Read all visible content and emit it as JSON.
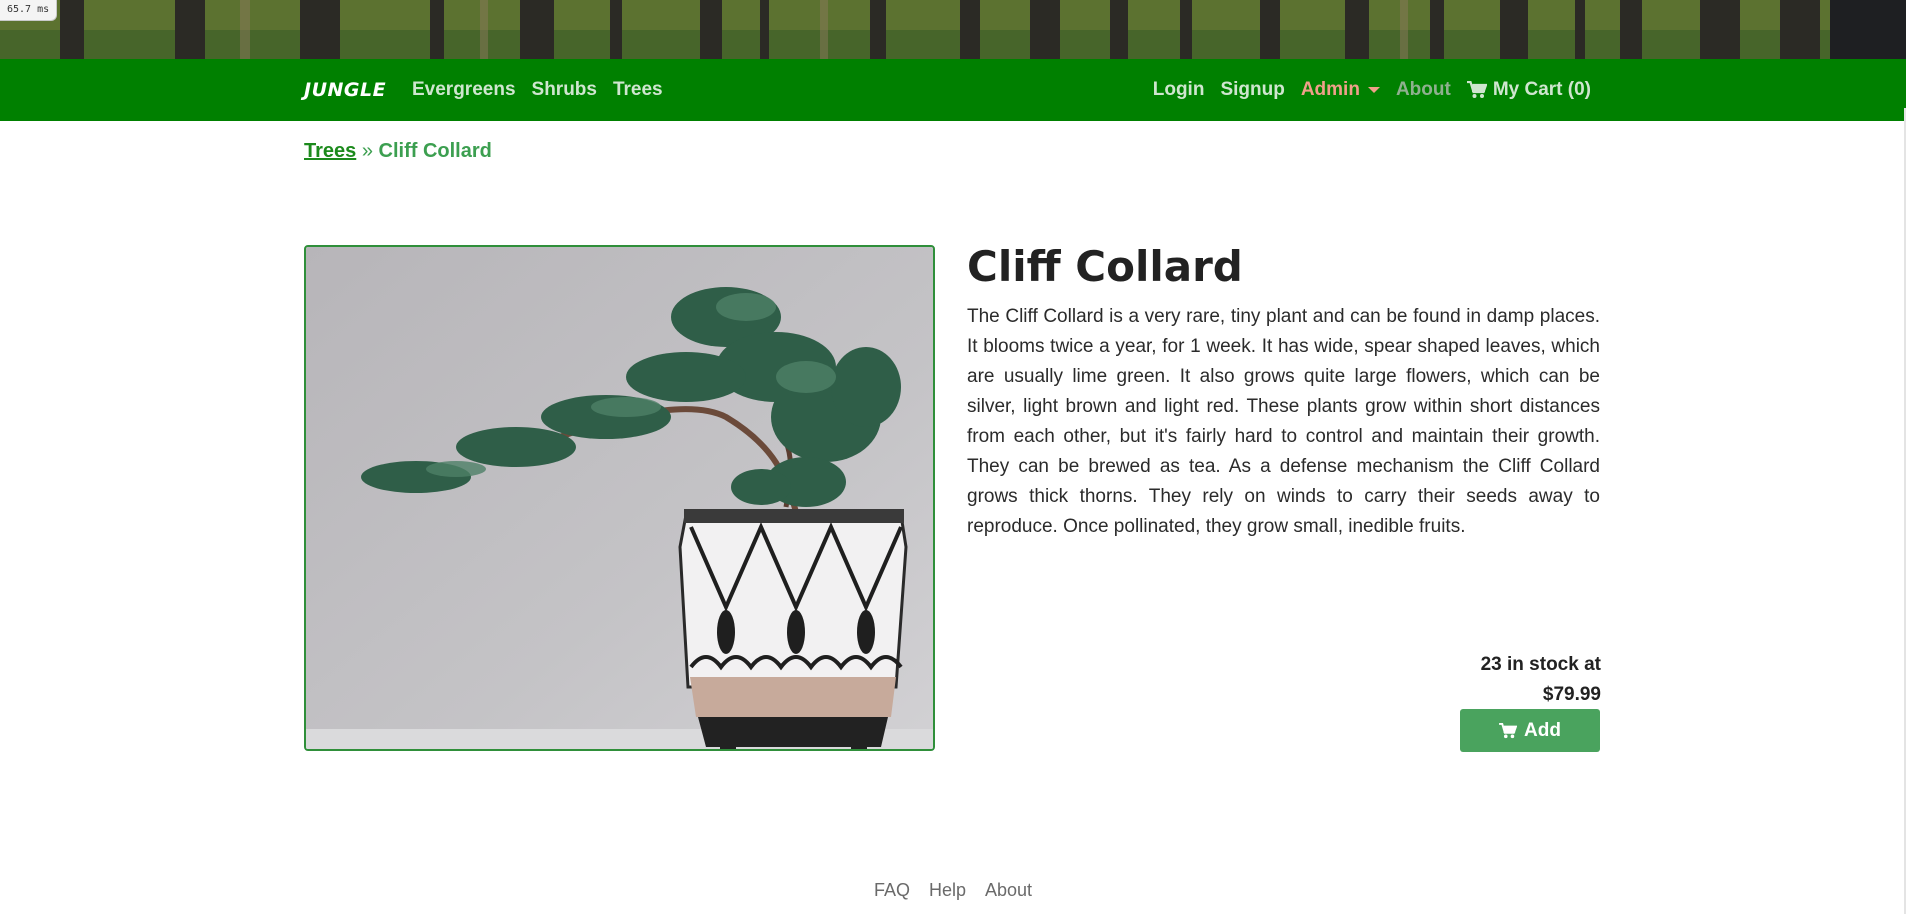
{
  "timer": "65.7 ms",
  "nav": {
    "brand": "JUNGLE",
    "left_links": [
      "Evergreens",
      "Shrubs",
      "Trees"
    ],
    "login": "Login",
    "signup": "Signup",
    "admin": "Admin",
    "about": "About",
    "cart": "My Cart (0)"
  },
  "breadcrumb": {
    "parent": "Trees",
    "separator": "»",
    "current": "Cliff Collard"
  },
  "product": {
    "name": "Cliff Collard",
    "description": "The Cliff Collard is a very rare, tiny plant and can be found in damp places. It blooms twice a year, for 1 week. It has wide, spear shaped leaves, which are usually lime green. It also grows quite large flowers, which can be silver, light brown and light red. These plants grow within short distances from each other, but it's fairly hard to control and maintain their growth. They can be brewed as tea. As a defense mechanism the Cliff Collard grows thick thorns. They rely on winds to carry their seeds away to reproduce. Once pollinated, they grow small, inedible fruits.",
    "stock": "23 in stock at",
    "price": "$79.99",
    "add_label": "Add"
  },
  "footer": {
    "links": [
      "FAQ",
      "Help",
      "About"
    ]
  },
  "colors": {
    "navbar": "#008000",
    "button": "#4aa35e",
    "admin_link": "#f0a08a"
  }
}
